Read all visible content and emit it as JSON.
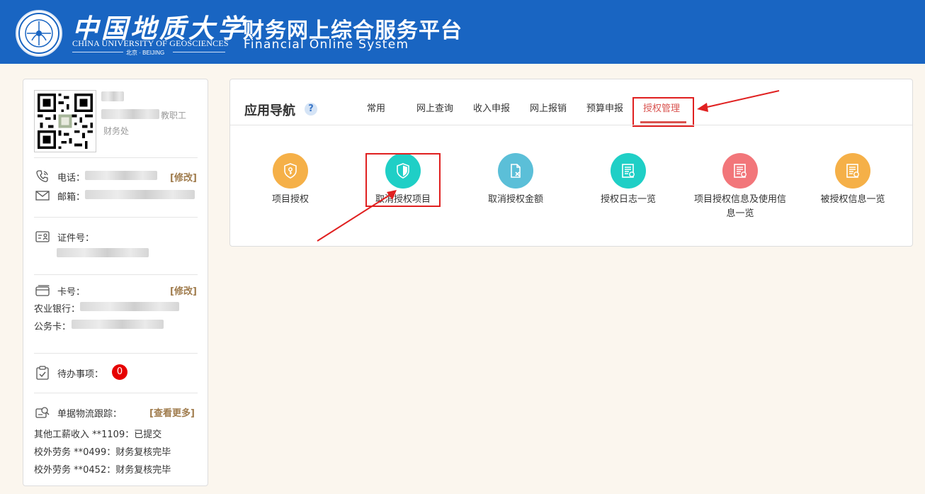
{
  "header": {
    "university_cn": "中国地质大学",
    "university_en": "CHINA UNIVERSITY OF GEOSCIENCES",
    "university_city": "北京 · BEIJING",
    "system_cn": "财务网上综合服务平台",
    "system_en": "Financial Online System"
  },
  "profile": {
    "role": "教职工",
    "department": "财务处",
    "phone_label": "电话：",
    "email_label": "邮箱：",
    "edit_label": "[修改]",
    "id_label": "证件号：",
    "card_label": "卡号：",
    "bank_label": "农业银行：",
    "official_card_label": "公务卡：",
    "todo_label": "待办事项：",
    "todo_count": "0",
    "tracking_label": "单据物流跟踪：",
    "more_label": "[查看更多]",
    "tracking": [
      "其他工薪收入 **1109：已提交",
      "校外劳务 **0499：财务复核完毕",
      "校外劳务 **0452：财务复核完毕"
    ]
  },
  "nav": {
    "title": "应用导航",
    "help": "?",
    "tabs": [
      "常用",
      "网上查询",
      "收入申报",
      "网上报销",
      "预算申报",
      "授权管理"
    ],
    "active_tab": "授权管理"
  },
  "apps": [
    {
      "label": "项目授权",
      "color": "#f5b048",
      "icon": "key-shield-icon"
    },
    {
      "label": "取消授权项目",
      "color": "#1fcfc6",
      "icon": "shield-icon"
    },
    {
      "label": "取消授权金额",
      "color": "#5bbfd8",
      "icon": "document-x-icon"
    },
    {
      "label": "授权日志一览",
      "color": "#1fcfc6",
      "icon": "list-icon"
    },
    {
      "label": "项目授权信息及使用信息一览",
      "color": "#f2767a",
      "icon": "list-icon"
    },
    {
      "label": "被授权信息一览",
      "color": "#f5b048",
      "icon": "list-icon"
    }
  ],
  "colors": {
    "header_bg": "#1965c2",
    "page_bg": "#fbf6ee",
    "active_tab": "#d9534f",
    "badge": "#e60000",
    "link": "#a07c4d",
    "annotation": "#e02020"
  }
}
